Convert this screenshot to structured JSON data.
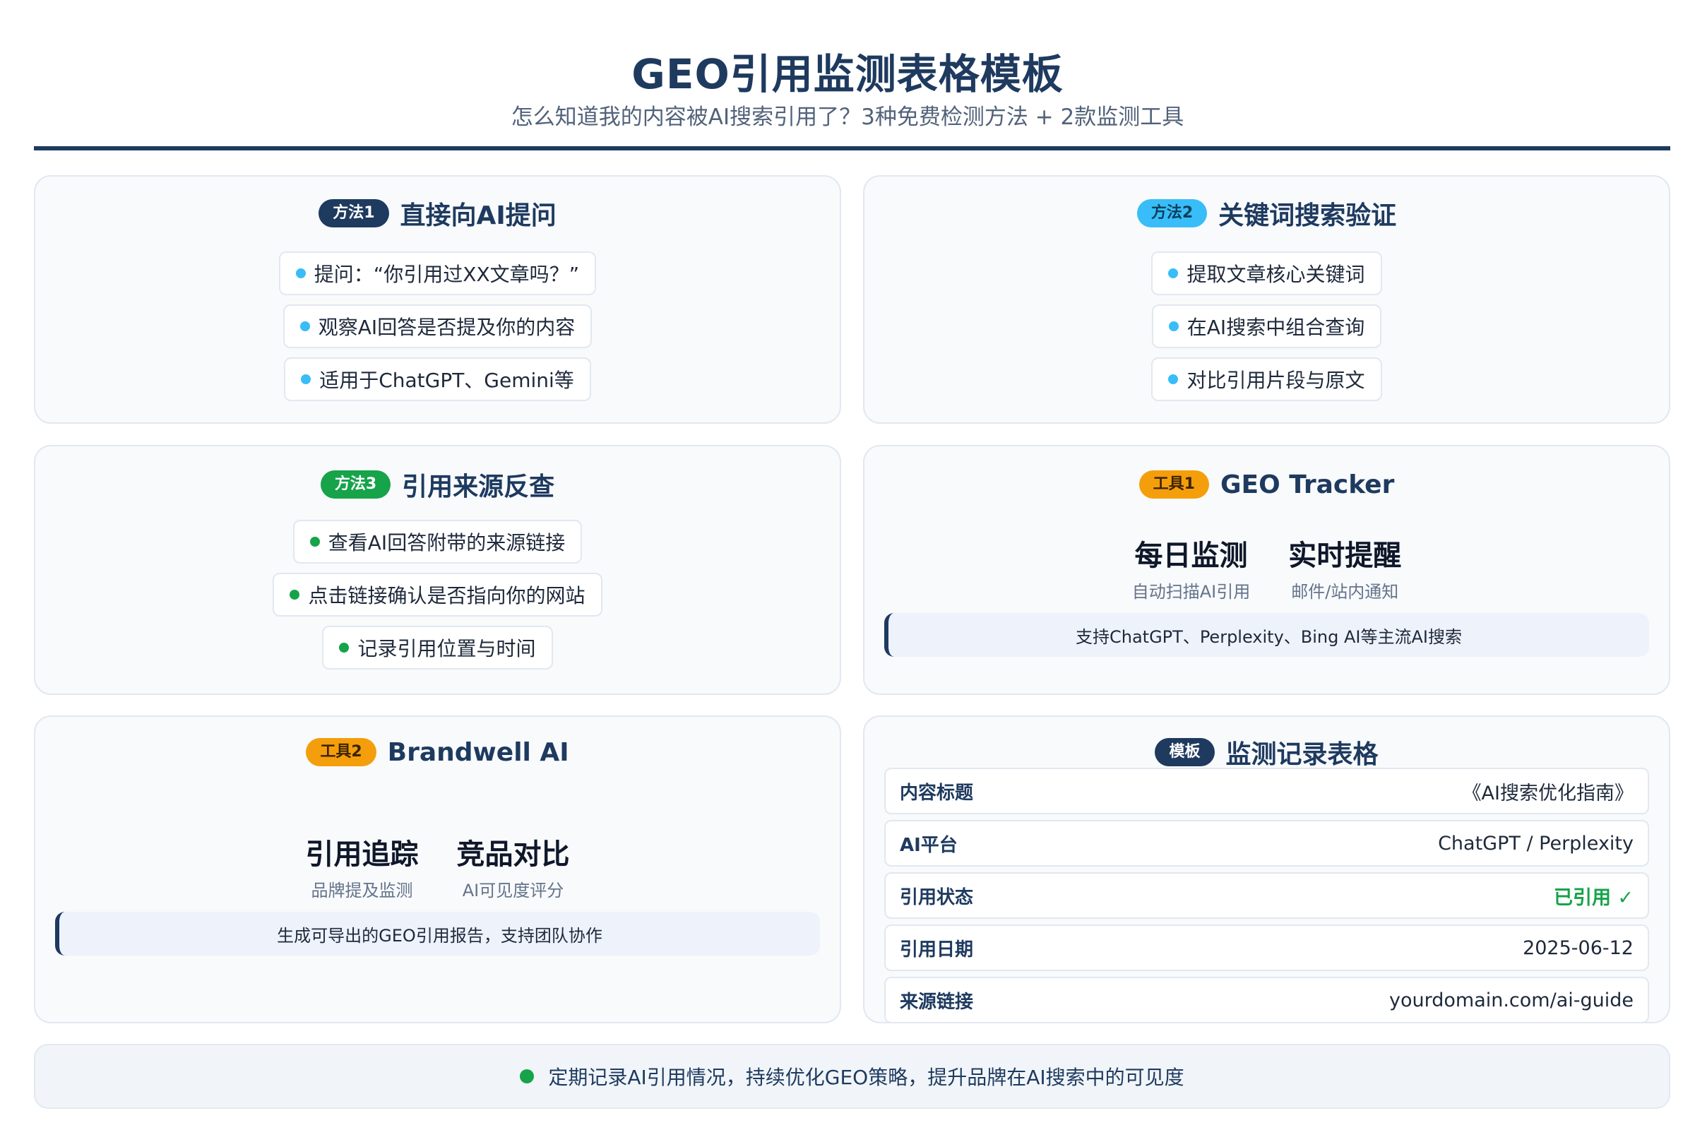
{
  "header": {
    "title": "GEO引用监测表格模板",
    "subtitle": "怎么知道我的内容被AI搜索引用了？3种免费检测方法 + 2款监测工具"
  },
  "method1": {
    "badge": "方法1",
    "title": "直接向AI提问",
    "items": [
      "提问：“你引用过XX文章吗？”",
      "观察AI回答是否提及你的内容",
      "适用于ChatGPT、Gemini等"
    ]
  },
  "method2": {
    "badge": "方法2",
    "title": "关键词搜索验证",
    "items": [
      "提取文章核心关键词",
      "在AI搜索中组合查询",
      "对比引用片段与原文"
    ]
  },
  "method3": {
    "badge": "方法3",
    "title": "引用来源反查",
    "items": [
      "查看AI回答附带的来源链接",
      "点击链接确认是否指向你的网站",
      "记录引用位置与时间"
    ]
  },
  "tool1": {
    "badge": "工具1",
    "title": "GEO Tracker",
    "features": [
      {
        "title": "每日监测",
        "desc": "自动扫描AI引用"
      },
      {
        "title": "实时提醒",
        "desc": "邮件/站内通知"
      }
    ],
    "note": "支持ChatGPT、Perplexity、Bing AI等主流AI搜索"
  },
  "tool2": {
    "badge": "工具2",
    "title": "Brandwell AI",
    "features": [
      {
        "title": "引用追踪",
        "desc": "品牌提及监测"
      },
      {
        "title": "竞品对比",
        "desc": "AI可见度评分"
      }
    ],
    "note": "生成可导出的GEO引用报告，支持团队协作"
  },
  "template": {
    "badge": "模板",
    "title": "监测记录表格",
    "rows": [
      {
        "label": "内容标题",
        "value": "《AI搜索优化指南》"
      },
      {
        "label": "AI平台",
        "value": "ChatGPT / Perplexity"
      },
      {
        "label": "引用状态",
        "value": "已引用 ✓"
      },
      {
        "label": "引用日期",
        "value": "2025-06-12"
      },
      {
        "label": "来源链接",
        "value": "yourdomain.com/ai-guide"
      }
    ]
  },
  "footer": {
    "text": "定期记录AI引用情况，持续优化GEO策略，提升品牌在AI搜索中的可见度"
  },
  "colors": {
    "navy": "#1e3a5f",
    "sky": "#38bdf8",
    "green": "#16a34a",
    "amber": "#f59e0b"
  }
}
